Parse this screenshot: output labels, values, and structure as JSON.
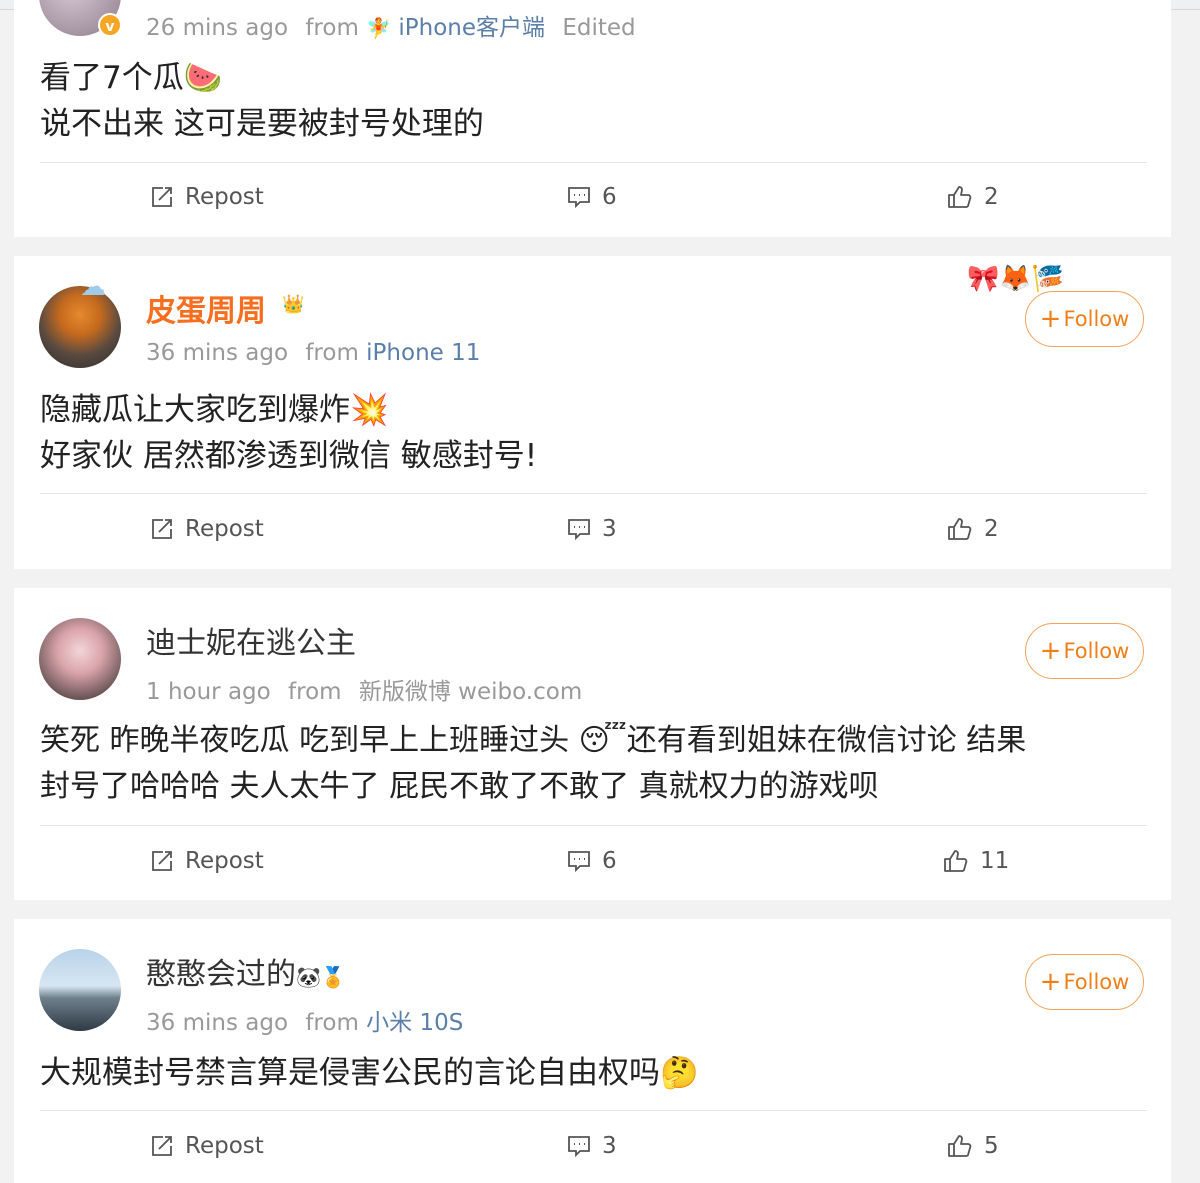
{
  "labels": {
    "repost": "Repost",
    "follow": "Follow"
  },
  "comments": [
    {
      "time": "26 mins ago",
      "from_label": "from",
      "source": "iPhone客户端",
      "edited": "Edited",
      "lines": [
        "看了7个瓜🍉",
        "说不出来 这可是要被封号处理的"
      ],
      "comments_count": "6",
      "likes": "2"
    },
    {
      "name": "皮蛋周周",
      "time": "36 mins ago",
      "from_label": "from",
      "source": "iPhone 11",
      "lines": [
        "隐藏瓜让大家吃到爆炸💥",
        "好家伙 居然都渗透到微信  敏感封号!"
      ],
      "comments_count": "3",
      "likes": "2"
    },
    {
      "name": "迪士妮在逃公主",
      "time": "1 hour ago",
      "from_label": "from",
      "source": "新版微博 weibo.com",
      "lines": [
        "笑死  昨晚半夜吃瓜 吃到早上上班睡过头 😴还有看到姐妹在微信讨论 结果",
        "封号了哈哈哈  夫人太牛了   屁民不敢了不敢了   真就权力的游戏呗"
      ],
      "comments_count": "6",
      "likes": "11"
    },
    {
      "name": "憨憨会过的",
      "time": "36 mins ago",
      "from_label": "from",
      "source": "小米 10S",
      "lines": [
        "大规模封号禁言算是侵害公民的言论自由权吗🤔"
      ],
      "comments_count": "3",
      "likes": "5"
    }
  ],
  "colors": {
    "vip_name": "#f86e1e",
    "source_link": "#5b7fa8",
    "follow": "#f07f1a"
  }
}
